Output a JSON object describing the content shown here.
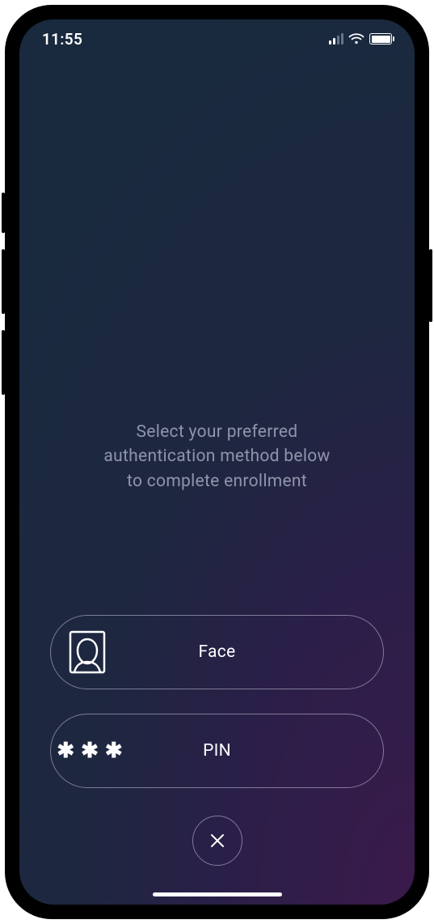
{
  "status": {
    "time": "11:55"
  },
  "prompt_line1": "Select your preferred",
  "prompt_line2": "authentication method below",
  "prompt_line3": "to complete enrollment",
  "options": {
    "face": {
      "label": "Face"
    },
    "pin": {
      "label": "PIN"
    }
  }
}
